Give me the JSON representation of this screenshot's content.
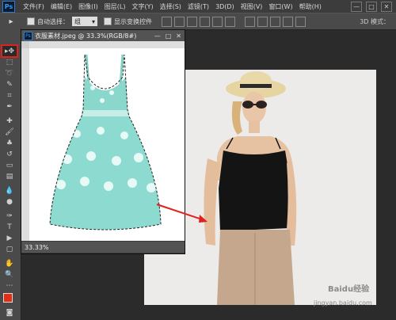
{
  "app": {
    "logo": "Ps",
    "menu": [
      "文件(F)",
      "编辑(E)",
      "图像(I)",
      "图层(L)",
      "文字(Y)",
      "选择(S)",
      "滤镜(T)",
      "3D(D)",
      "视图(V)",
      "窗口(W)",
      "帮助(H)"
    ],
    "window_controls": [
      "—",
      "□",
      "✕"
    ]
  },
  "options": {
    "tool_glyph": "▸",
    "auto_select_label": "自动选择：",
    "auto_select_value": "组",
    "show_transform_label": "显示变换控件",
    "mode_3d_label": "3D 模式："
  },
  "document": {
    "title": "衣服素材.jpeg @ 33.3%(RGB/8#)",
    "zoom": "33.33%",
    "controls": [
      "—",
      "□",
      "✕"
    ]
  },
  "watermark": {
    "logo": "Baidu经验",
    "url": "jingyan.baidu.com"
  },
  "colors": {
    "foreground": "#e52d14",
    "background": "#ffffff",
    "highlight": "#e0201c"
  }
}
